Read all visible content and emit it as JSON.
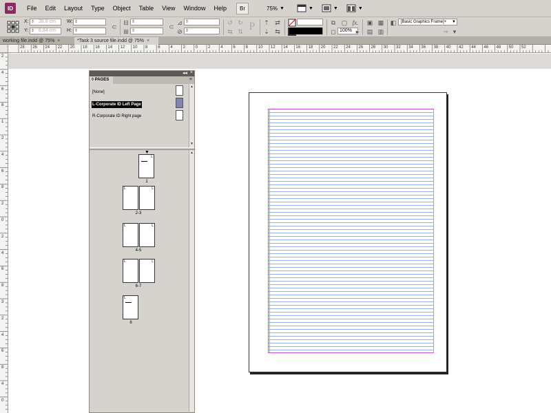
{
  "app": {
    "logo_text": "ID",
    "menu": [
      "File",
      "Edit",
      "Layout",
      "Type",
      "Object",
      "Table",
      "View",
      "Window",
      "Help"
    ],
    "br_label": "Br",
    "zoom": "75%"
  },
  "control_panel": {
    "x_label": "X:",
    "x_value": "28.8 cm",
    "y_label": "Y:",
    "y_value": "6.84 cm",
    "w_label": "W:",
    "h_label": "H:",
    "stroke_percent": "100%",
    "object_style": "[Basic Graphics Frame]+"
  },
  "tabs": [
    {
      "label": "working file.indd @ 75%",
      "close": "×"
    },
    {
      "label": "*Task 3 source file.indd @ 75%",
      "close": "×"
    }
  ],
  "h_ruler_labels": [
    "28",
    "26",
    "24",
    "22",
    "20",
    "18",
    "16",
    "14",
    "12",
    "10",
    "8",
    "6",
    "4",
    "2",
    "0",
    "2",
    "4",
    "6",
    "8",
    "10",
    "12",
    "14",
    "16",
    "18",
    "20",
    "22",
    "24",
    "26",
    "28",
    "30",
    "32",
    "34",
    "36",
    "38",
    "40",
    "42",
    "44",
    "46",
    "48",
    "50",
    "52"
  ],
  "v_ruler_labels": [
    "2",
    "4",
    "6",
    "8",
    "1",
    "2",
    "4",
    "6",
    "8",
    "2",
    "0",
    "2",
    "4",
    "6",
    "8",
    "3",
    "2",
    "4",
    "6",
    "8",
    "4",
    "0"
  ],
  "pages_panel": {
    "title": "PAGES",
    "masters": [
      {
        "label": "[None]",
        "selected": false
      },
      {
        "label": "L-Corporate ID Left Page",
        "selected": true
      },
      {
        "label": "R-Corporate ID Right page",
        "selected": false
      }
    ],
    "spreads": [
      {
        "label": "1"
      },
      {
        "label": "2-3"
      },
      {
        "label": "4-5"
      },
      {
        "label": "6-7"
      },
      {
        "label": "8"
      }
    ],
    "master_prefix": "L"
  },
  "colors": {
    "margin_guide": "#c84fd2",
    "baseline_grid": "#8fb0e8",
    "master_selected_thumb": "#7e86b0"
  }
}
